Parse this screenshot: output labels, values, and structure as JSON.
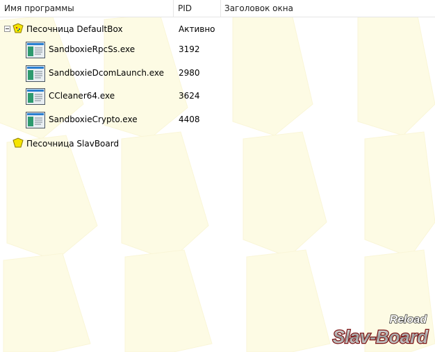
{
  "columns": {
    "name": "Имя программы",
    "pid": "PID",
    "title": "Заголовок окна"
  },
  "tree": {
    "sandbox1": {
      "name": "Песочница DefaultBox",
      "status": "Активно",
      "expanded": true
    },
    "processes": [
      {
        "name": "SandboxieRpcSs.exe",
        "pid": "3192"
      },
      {
        "name": "SandboxieDcomLaunch.exe",
        "pid": "2980"
      },
      {
        "name": "CCleaner64.exe",
        "pid": "3624"
      },
      {
        "name": "SandboxieCrypto.exe",
        "pid": "4408"
      }
    ],
    "sandbox2": {
      "name": "Песочница SlavBoard"
    }
  },
  "icons": {
    "sandbox_active": "sandbox-active-icon",
    "sandbox_idle": "sandbox-icon",
    "process": "exe-window-icon",
    "collapse": "collapse-icon"
  },
  "colors": {
    "watermark": "#fdfbe4",
    "sandbox_yellow": "#f5e400",
    "header_border": "#e5e5e5"
  },
  "logo": {
    "line1": "Reload",
    "line2": "Slav-Board"
  }
}
